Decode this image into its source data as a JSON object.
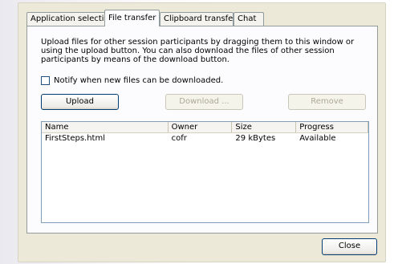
{
  "tabs": [
    {
      "label": "Application selection"
    },
    {
      "label": "File transfer"
    },
    {
      "label": "Clipboard transfer"
    },
    {
      "label": "Chat"
    }
  ],
  "active_tab": "File transfer",
  "description": "Upload files for other session participants by dragging them to this window or using the upload button. You can also download the files of other session participants by means of the download button.",
  "notify": {
    "label": "Notify when new files can be downloaded.",
    "checked": false
  },
  "buttons": {
    "upload": "Upload",
    "download": "Download ...",
    "remove": "Remove",
    "close": "Close"
  },
  "table": {
    "headers": [
      "Name",
      "Owner",
      "Size",
      "Progress"
    ],
    "rows": [
      {
        "name": "FirstSteps.html",
        "owner": "cofr",
        "size": "29 kBytes",
        "progress": "Available"
      }
    ]
  }
}
